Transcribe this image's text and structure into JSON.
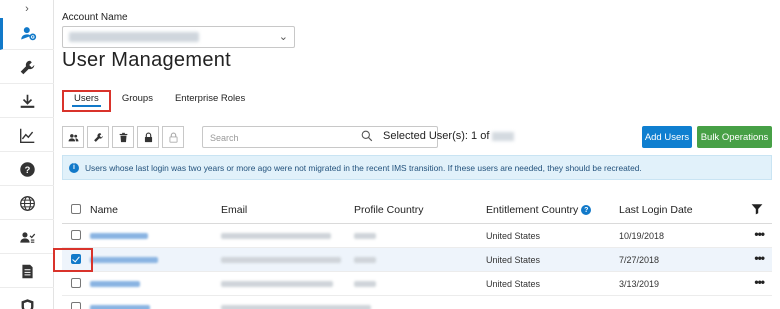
{
  "account": {
    "label": "Account Name"
  },
  "page": {
    "title": "User Management"
  },
  "tabs": [
    {
      "label": "Users"
    },
    {
      "label": "Groups"
    },
    {
      "label": "Enterprise Roles"
    }
  ],
  "search": {
    "placeholder": "Search"
  },
  "selection": {
    "label": "Selected User(s): 1 of"
  },
  "buttons": {
    "add_users": "Add Users",
    "bulk_operations": "Bulk Operations"
  },
  "banner": {
    "text": "Users whose last login was two years or more ago were not migrated in the recent IMS transition. If these users are needed, they should be recreated."
  },
  "table": {
    "columns": [
      "Name",
      "Email",
      "Profile Country",
      "Entitlement Country",
      "Last Login Date"
    ],
    "rows": [
      {
        "entitlement_country": "United States",
        "last_login": "10/19/2018",
        "checked": false,
        "actions": "•••"
      },
      {
        "entitlement_country": "United States",
        "last_login": "7/27/2018",
        "checked": true,
        "actions": "•••"
      },
      {
        "entitlement_country": "United States",
        "last_login": "3/13/2019",
        "checked": false,
        "actions": "•••"
      }
    ]
  },
  "sidebar": {
    "expand_glyph": "›",
    "items": [
      {
        "icon": "user-settings-icon",
        "active": true
      },
      {
        "icon": "wrench-icon",
        "active": false
      },
      {
        "icon": "download-icon",
        "active": false
      },
      {
        "icon": "line-chart-icon",
        "active": false
      },
      {
        "icon": "help-icon",
        "active": false
      },
      {
        "icon": "globe-icon",
        "active": false
      },
      {
        "icon": "user-check-icon",
        "active": false
      },
      {
        "icon": "document-icon",
        "active": false
      },
      {
        "icon": "shield-icon",
        "active": false
      }
    ]
  },
  "colors": {
    "accent": "#1179c9",
    "add_button": "#0f7fd0",
    "bulk_button": "#47a046",
    "highlight": "#d9332b",
    "banner_bg": "#e1f1fa"
  }
}
